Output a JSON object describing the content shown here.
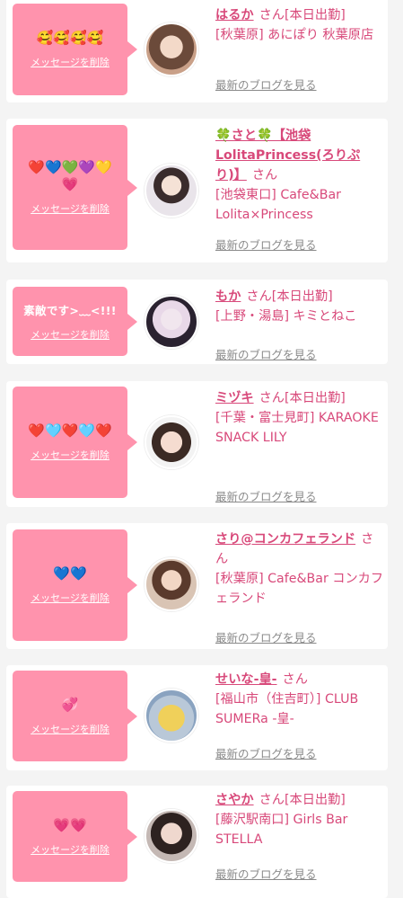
{
  "common": {
    "delete_label": "メッセージを削除",
    "blog_label": "最新のブログを見る",
    "san": "さん"
  },
  "cards": [
    {
      "message": "🥰🥰🥰🥰",
      "name": "はるか",
      "status": "[本日出勤]",
      "shop": "[秋葉原] あにぽり 秋葉原店"
    },
    {
      "message": "❤️💙💚💜💛💗",
      "name": "🍀さと🍀【池袋LolitaPrincess(ろりぷり)】",
      "status": "",
      "shop": "[池袋東口] Cafe&Bar Lolita×Princess"
    },
    {
      "message": "素敵です>﹏<!!!",
      "name": "もか",
      "status": "[本日出勤]",
      "shop": "[上野・湯島] キミとねこ"
    },
    {
      "message": "❤️🩵❤️🩵❤️",
      "name": "ミヅキ",
      "status": "[本日出勤]",
      "shop": "[千葉・富士見町] KARAOKE SNACK LILY"
    },
    {
      "message": "💙💙",
      "name": "さり@コンカフェランド",
      "status": "",
      "shop": "[秋葉原] Cafe&Bar コンカフェランド"
    },
    {
      "message": "💞",
      "name": "せいな-皇-",
      "status": "",
      "shop": "[福山市（住吉町）] CLUB SUMERa -皇-"
    },
    {
      "message": "💗💗",
      "name": "さやか",
      "status": "[本日出勤]",
      "shop": "[藤沢駅南口] Girls Bar STELLA"
    }
  ]
}
